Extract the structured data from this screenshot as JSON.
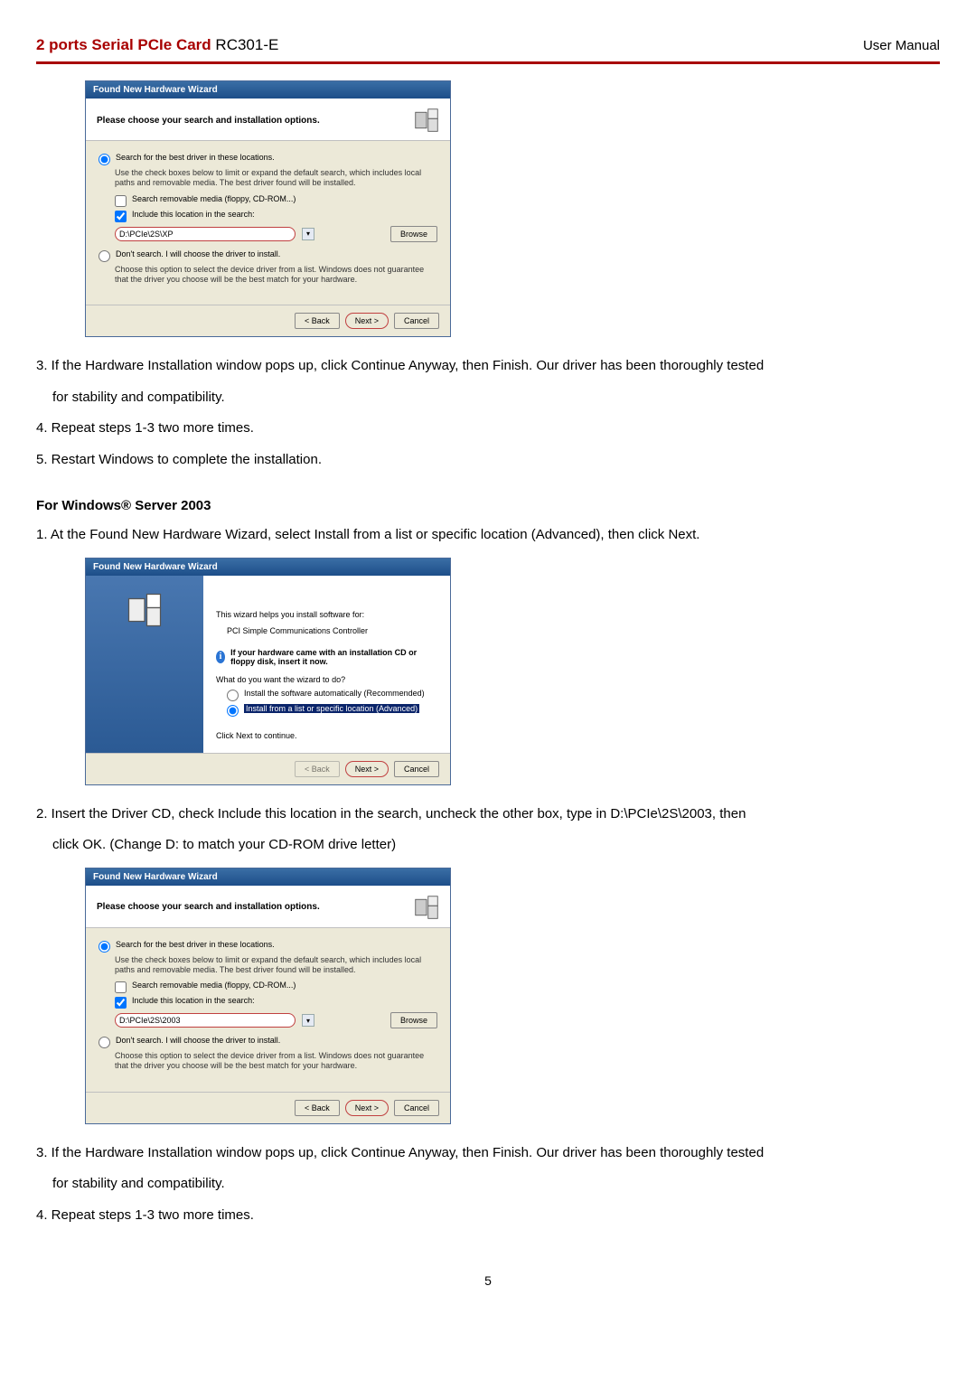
{
  "header": {
    "title_red": "2 ports Serial PCIe Card",
    "title_black": " RC301-E",
    "manual": "User Manual"
  },
  "wizard_common": {
    "titlebar": "Found New Hardware Wizard",
    "subhead": "Please choose your search and installation options.",
    "radio_search": "Search for the best driver in these locations.",
    "search_desc": "Use the check boxes below to limit or expand the default search, which includes local paths and removable media. The best driver found will be installed.",
    "chk_removable": "Search removable media (floppy, CD-ROM...)",
    "chk_include": "Include this location in the search:",
    "radio_dont": "Don't search. I will choose the driver to install.",
    "dont_desc": "Choose this option to select the device driver from a list. Windows does not guarantee that the driver you choose will be the best match for your hardware.",
    "browse": "Browse",
    "back": "< Back",
    "next": "Next >",
    "cancel": "Cancel"
  },
  "wizard1": {
    "path": "D:\\PCIe\\2S\\XP"
  },
  "wizard3": {
    "path": "D:\\PCIe\\2S\\2003"
  },
  "wizard2": {
    "intro": "This wizard helps you install software for:",
    "device": "PCI Simple Communications Controller",
    "cd_note": "If your hardware came with an installation CD or floppy disk, insert it now.",
    "question": "What do you want the wizard to do?",
    "opt_auto": "Install the software automatically (Recommended)",
    "opt_list": "Install from a list or specific location (Advanced)",
    "click_next": "Click Next to continue."
  },
  "steps": {
    "s3a": "3. If the Hardware Installation window pops up, click Continue Anyway, then Finish. Our driver has been thoroughly tested",
    "s3a_cont": "for stability and compatibility.",
    "s4a": "4. Repeat steps 1-3 two more times.",
    "s5a": "5. Restart Windows to complete the installation.",
    "section": "For Windows® Server 2003",
    "s1b": "1. At the Found New Hardware Wizard, select Install from a list or specific location (Advanced), then click Next.",
    "s2b": "2. Insert the Driver CD, check Include this location in the search, uncheck the other box, type in D:\\PCIe\\2S\\2003, then",
    "s2b_cont": "click OK. (Change D: to match your CD-ROM drive letter)",
    "s3b": "3. If the Hardware Installation window pops up, click Continue Anyway, then Finish. Our driver has been thoroughly tested",
    "s3b_cont": "for stability and compatibility.",
    "s4b": "4. Repeat steps 1-3 two more times."
  },
  "page": "5"
}
